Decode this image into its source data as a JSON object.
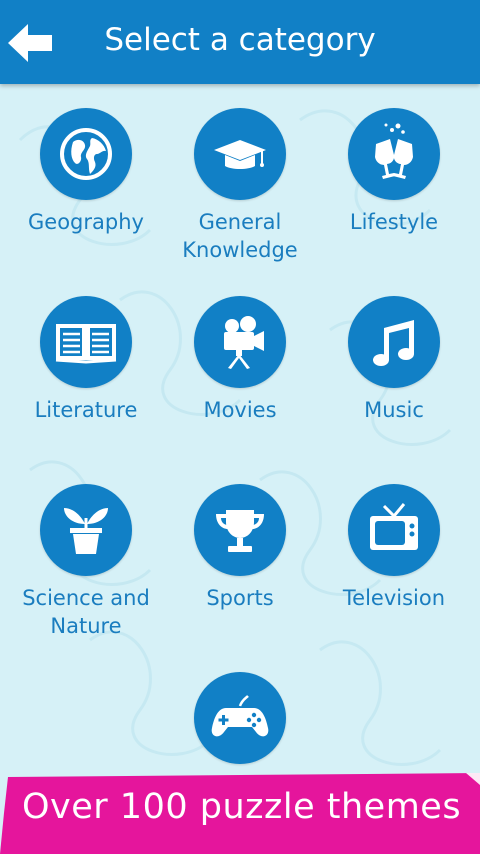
{
  "header": {
    "title": "Select a category"
  },
  "categories": [
    {
      "label": "Geography"
    },
    {
      "label": "General\nKnowledge"
    },
    {
      "label": "Lifestyle"
    },
    {
      "label": "Literature"
    },
    {
      "label": "Movies"
    },
    {
      "label": "Music"
    },
    {
      "label": "Science and\nNature"
    },
    {
      "label": "Sports"
    },
    {
      "label": "Television"
    },
    {
      "label": ""
    }
  ],
  "banner": {
    "text": "Over 100 puzzle themes"
  },
  "colors": {
    "primary": "#1180c6",
    "background": "#d6f1f7",
    "label": "#1a7dbf",
    "banner": "#e5159c"
  }
}
